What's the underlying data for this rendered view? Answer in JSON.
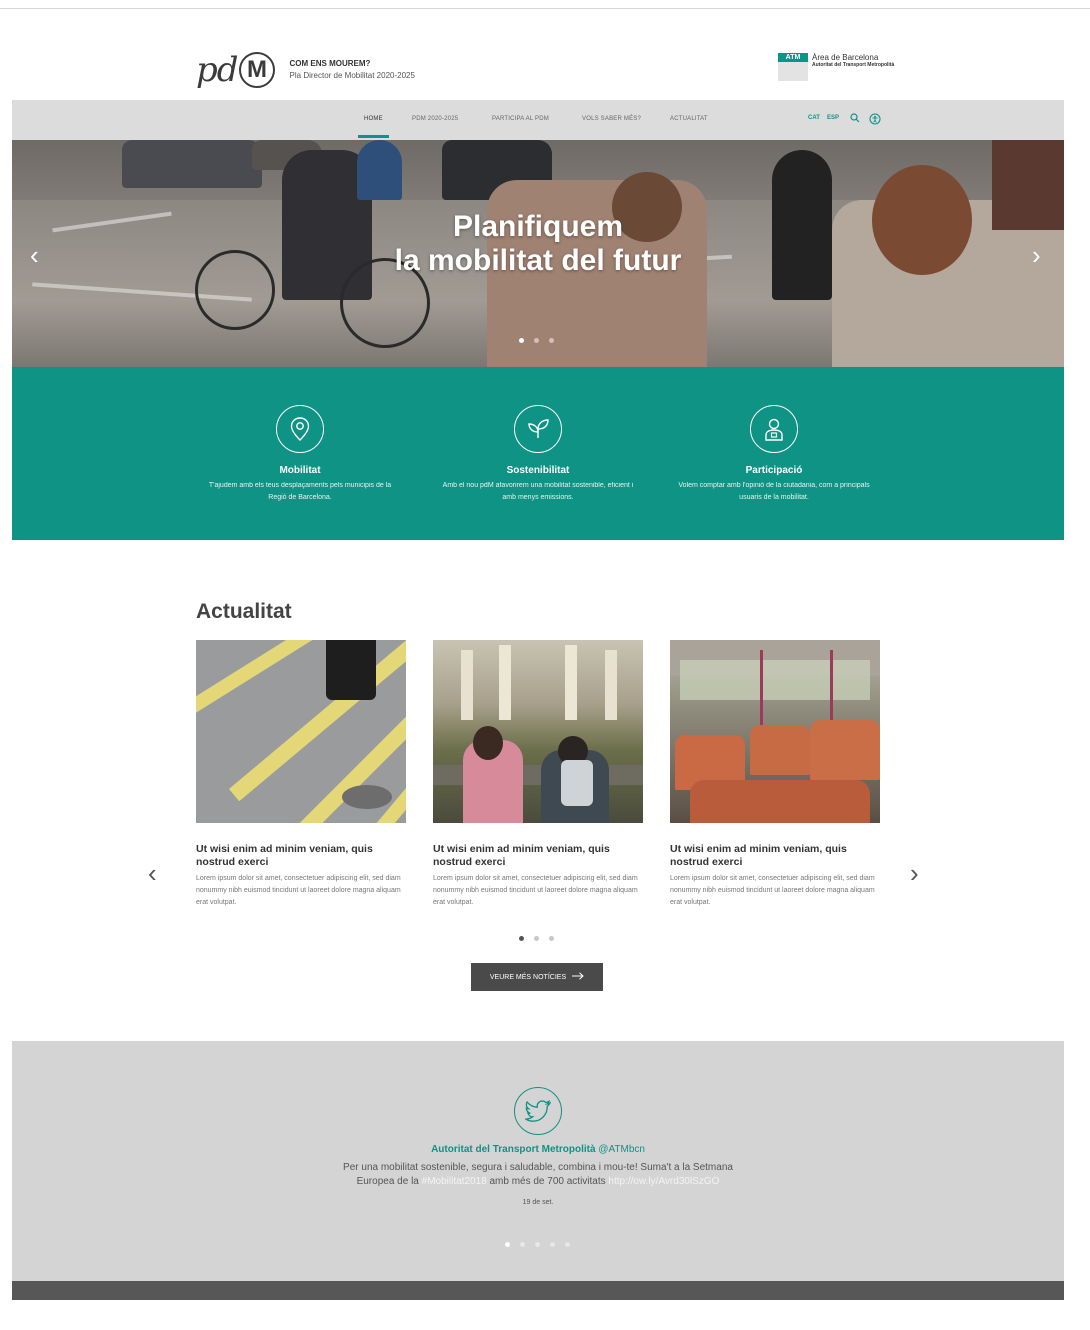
{
  "header": {
    "logo_left": "pd",
    "logo_m": "M",
    "tagline": "COM ENS MOUREM?",
    "subtitle": "Pla Director de Mobilitat 2020-2025",
    "atm_badge": "ATM",
    "atm_title": "Àrea de Barcelona",
    "atm_sub": "Autoritat del Transport Metropolità"
  },
  "nav": {
    "items": [
      "HOME",
      "PDM 2020-2025",
      "PARTICIPA AL PDM",
      "VOLS SABER MÉS?",
      "ACTUALITAT"
    ],
    "lang_cat": "CAT",
    "lang_esp": "ESP"
  },
  "hero": {
    "line1": "Planifiquem",
    "line2": "la mobilitat del futur"
  },
  "features": [
    {
      "title": "Mobilitat",
      "desc": "T'ajudem amb els teus desplaçaments pels municipis de la Regió de Barcelona."
    },
    {
      "title": "Sostenibilitat",
      "desc": "Amb el nou pdM afavorirem una mobilitat sostenible, eficient i amb menys emissions."
    },
    {
      "title": "Participació",
      "desc": "Volem comptar amb l'opinió de la ciutadania, com a principals usuaris de la mobilitat."
    }
  ],
  "news": {
    "title": "Actualitat",
    "cards": [
      {
        "heading": "Ut wisi enim ad minim veniam, quis nostrud exerci",
        "body": "Lorem ipsum dolor sit amet, consectetuer adipiscing elit, sed diam nonummy nibh euismod tincidunt ut laoreet dolore magna aliquam erat volutpat."
      },
      {
        "heading": "Ut wisi enim ad minim veniam, quis nostrud exerci",
        "body": "Lorem ipsum dolor sit amet, consectetuer adipiscing elit, sed diam nonummy nibh euismod tincidunt ut laoreet dolore magna aliquam erat volutpat."
      },
      {
        "heading": "Ut wisi enim ad minim veniam, quis nostrud exerci",
        "body": "Lorem ipsum dolor sit amet, consectetuer adipiscing elit, sed diam nonummy nibh euismod tincidunt ut laoreet dolore magna aliquam erat volutpat."
      }
    ],
    "more_button": "VEURE MÉS NOTÍCIES"
  },
  "twitter": {
    "author": "Autoritat del Transport Metropolità",
    "handle": "@ATMbcn",
    "text_1": "Per una mobilitat sostenible, segura i saludable, combina i mou-te! Suma't a la Setmana",
    "text_2a": "Europea de la",
    "hashtag": "#Mobilitat2018",
    "text_2b": "amb més de 700 activitats",
    "link": "http://ow.ly/Avrd30lSzGO",
    "date": "19 de set."
  },
  "colors": {
    "accent": "#0e9384",
    "nav_bg": "#dcdcdc",
    "twitter_bg": "#d4d4d4",
    "footer_bg": "#575757"
  }
}
